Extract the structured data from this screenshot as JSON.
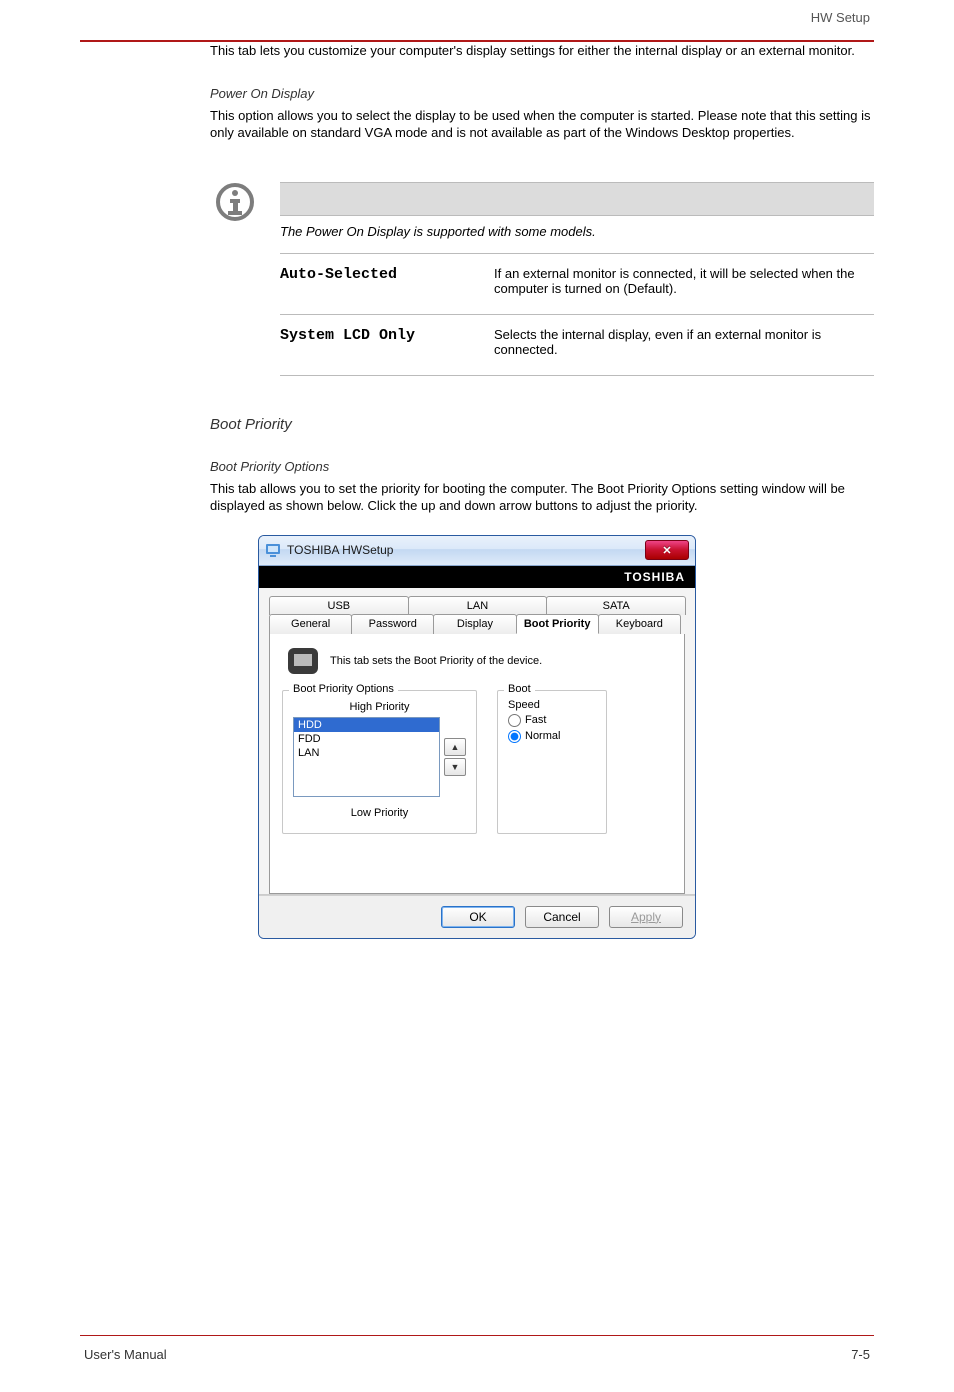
{
  "header": {
    "right": "HW Setup"
  },
  "intro": {
    "para": "This tab lets you customize your computer's display settings for either the internal display or an external monitor.",
    "heading_ponc": "Power On Display",
    "ponc_desc": "This option allows you to select the display to be used when the computer is started. Please note that this setting is only available on standard VGA mode and is not available as part of the Windows Desktop properties.",
    "note": "The Power On Display is supported with some models."
  },
  "options": {
    "auto_term": "Auto-Selected",
    "auto_desc": "If an external monitor is connected, it will be selected when the computer is turned on (Default).",
    "lcd_term": "System LCD Only",
    "lcd_desc": "Selects the internal display, even if an external monitor is connected."
  },
  "section": {
    "boot_priority_heading": "Boot Priority",
    "boot_opts_heading": "Boot Priority Options",
    "boot_desc": "This tab allows you to set the priority for booting the computer. The Boot Priority Options setting window will be displayed as shown below. Click the up and down arrow buttons to adjust the priority."
  },
  "win": {
    "title": "TOSHIBA HWSetup",
    "brand": "TOSHIBA",
    "tabs_row1": [
      "USB",
      "LAN",
      "SATA"
    ],
    "tabs_row2": [
      "General",
      "Password",
      "Display",
      "Boot Priority",
      "Keyboard"
    ],
    "selected_tab": "Boot Priority",
    "intro_text": "This tab sets the Boot Priority of the device.",
    "left_legend": "Boot Priority Options",
    "high_label": "High Priority",
    "low_label": "Low Priority",
    "items": [
      "HDD",
      "FDD",
      "LAN"
    ],
    "right_legend": "Boot",
    "speed_label": "Speed",
    "fast_label": "Fast",
    "normal_label": "Normal",
    "buttons": {
      "ok": "OK",
      "cancel": "Cancel",
      "apply": "Apply"
    }
  },
  "footer": {
    "left": "User's Manual",
    "right": "7-5"
  }
}
